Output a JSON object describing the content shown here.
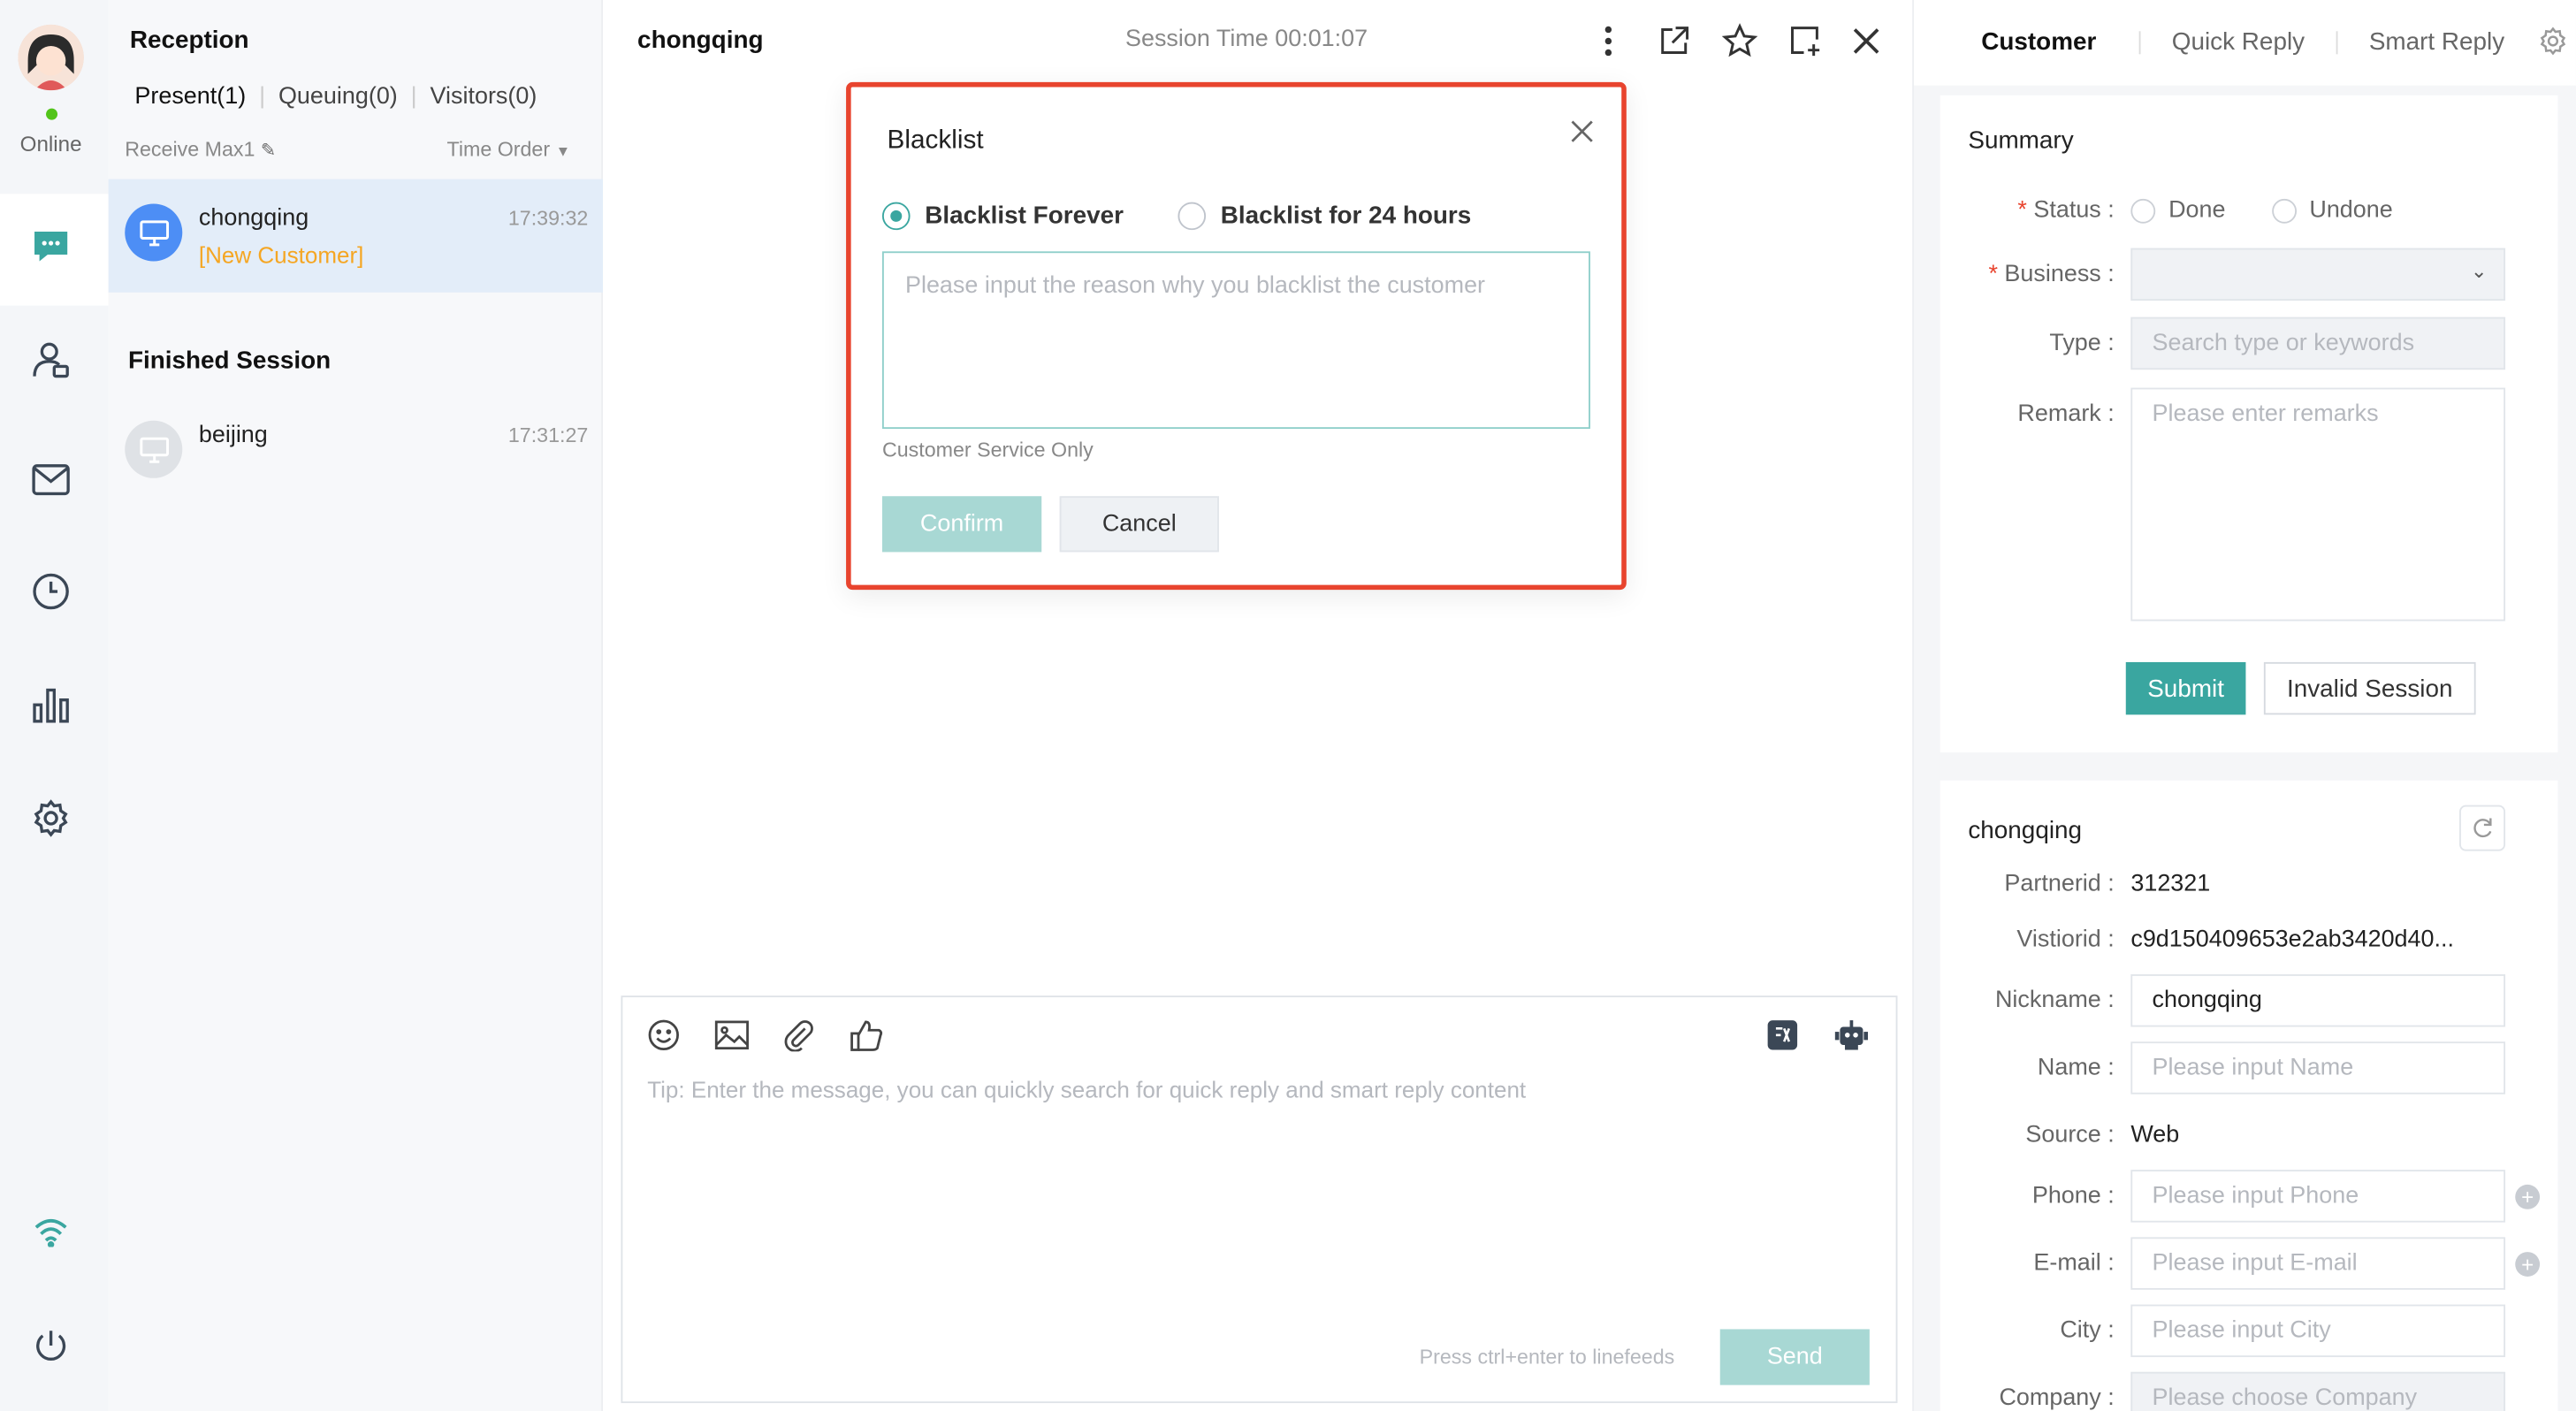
{
  "rail": {
    "status_label": "Online"
  },
  "sessions": {
    "title": "Reception",
    "tabs": [
      "Present(1)",
      "Queuing(0)",
      "Visitors(0)"
    ],
    "receive_max": "Receive Max1",
    "time_order": "Time Order",
    "active": [
      {
        "name": "chongqing",
        "time": "17:39:32",
        "tag": "[New Customer]"
      }
    ],
    "finished_title": "Finished Session",
    "finished": [
      {
        "name": "beijing",
        "time": "17:31:27"
      }
    ]
  },
  "chat": {
    "title": "chongqing",
    "session_time": "Session Time 00:01:07",
    "composer": {
      "tip": "Tip: Enter the message, you can quickly search for quick reply and smart reply content",
      "hint": "Press ctrl+enter to linefeeds",
      "send_label": "Send"
    }
  },
  "modal": {
    "title": "Blacklist",
    "option_forever": "Blacklist Forever",
    "option_24h": "Blacklist for 24 hours",
    "reason_placeholder": "Please input the reason why you blacklist the customer",
    "note": "Customer Service Only",
    "confirm_label": "Confirm",
    "cancel_label": "Cancel"
  },
  "right": {
    "tabs": [
      "Customer",
      "Quick Reply",
      "Smart Reply"
    ],
    "summary": {
      "title": "Summary",
      "status_label": "Status",
      "status_done": "Done",
      "status_undone": "Undone",
      "business_label": "Business",
      "type_label": "Type",
      "type_placeholder": "Search type or keywords",
      "remark_label": "Remark",
      "remark_placeholder": "Please enter remarks",
      "submit_label": "Submit",
      "invalid_label": "Invalid Session"
    },
    "customer": {
      "title": "chongqing",
      "partnerid_label": "Partnerid",
      "partnerid": "312321",
      "visitorid_label": "Vistiorid",
      "visitorid": "c9d150409653e2ab3420d40...",
      "nickname_label": "Nickname",
      "nickname": "chongqing",
      "name_label": "Name",
      "name_placeholder": "Please input Name",
      "source_label": "Source",
      "source": "Web",
      "phone_label": "Phone",
      "phone_placeholder": "Please input Phone",
      "email_label": "E-mail",
      "email_placeholder": "Please input E-mail",
      "city_label": "City",
      "city_placeholder": "Please input City",
      "company_label": "Company",
      "company_placeholder": "Please choose Company"
    }
  },
  "colors": {
    "accent": "#3aa6a0",
    "highlight_border": "#e8442e",
    "new_customer": "#f5a623"
  }
}
